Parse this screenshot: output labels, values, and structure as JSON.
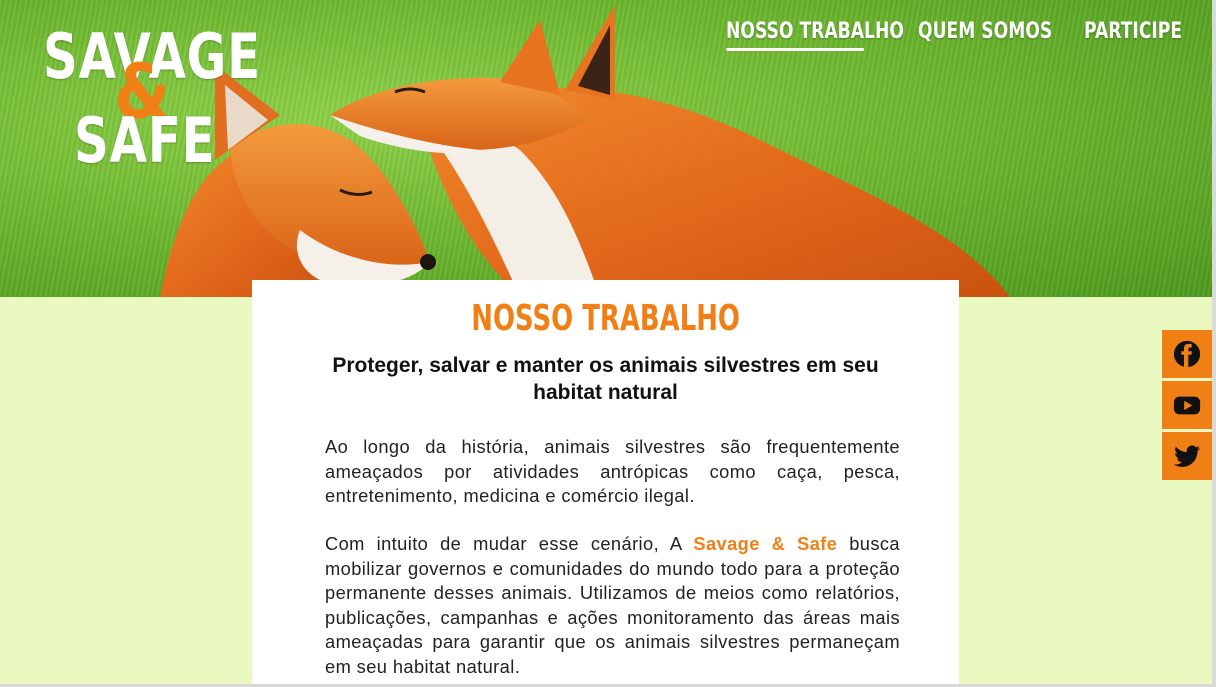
{
  "brand": {
    "logo_top": "SAVAGE",
    "logo_amp": "&",
    "logo_bottom": "SAFE",
    "name": "Savage & Safe",
    "accent_color": "#f07f16",
    "background_color": "#eaf9c0"
  },
  "nav": {
    "items": [
      {
        "label": "NOSSO TRABALHO",
        "active": true
      },
      {
        "label": "QUEM SOMOS",
        "active": false
      },
      {
        "label": "PARTICIPE",
        "active": false
      }
    ]
  },
  "hero": {
    "image_subject": "two red foxes on grass"
  },
  "main": {
    "title": "NOSSO TRABALHO",
    "subtitle": "Proteger, salvar e manter os animais silvestres em seu habitat natural",
    "paragraph1": "Ao longo da história, animais silvestres são frequentemente ameaçados por atividades antrópicas como caça, pesca, entretenimento, medicina e comércio ilegal.",
    "paragraph2_before": "Com intuito de mudar esse cenário, A",
    "paragraph2_brand": "Savage & Safe",
    "paragraph2_after": "busca mobilizar governos e comunidades do mundo todo para a proteção permanente desses animais. Utilizamos de meios como relatórios, publicações, campanhas e ações monitoramento das áreas mais ameaçadas para garantir que os animais silvestres permaneçam em seu habitat natural."
  },
  "social": {
    "items": [
      {
        "icon": "facebook-icon"
      },
      {
        "icon": "youtube-icon"
      },
      {
        "icon": "twitter-icon"
      }
    ]
  }
}
